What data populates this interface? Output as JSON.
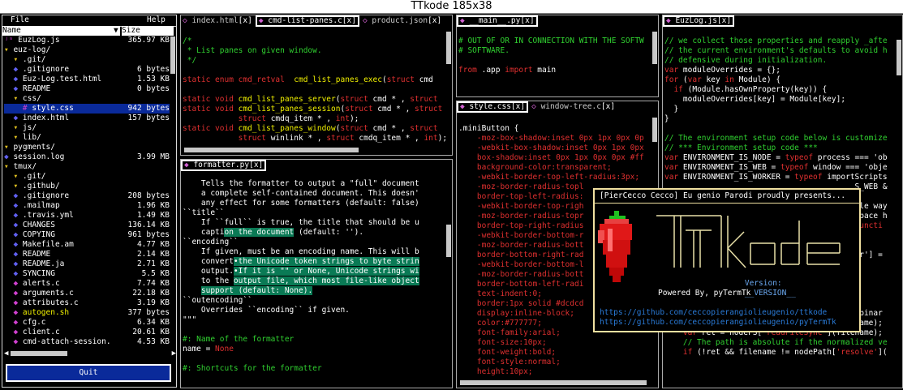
{
  "window": {
    "title": "TTkode 185x38"
  },
  "menu": {
    "file": "File",
    "help": "Help"
  },
  "file_tree": {
    "col_name": "Name",
    "col_size": "Size",
    "sort_indicator": "▼",
    "items": [
      {
        "icon": "js",
        "name": "EuzLog.js",
        "size": "365.97 KB",
        "indent": 0
      },
      {
        "icon": "folder",
        "name": "euz-log/",
        "size": "",
        "indent": 0
      },
      {
        "icon": "folder",
        "name": ".git/",
        "size": "",
        "indent": 1
      },
      {
        "icon": "file",
        "name": ".gitignore",
        "size": "6 bytes",
        "indent": 1
      },
      {
        "icon": "file",
        "name": "Euz-Log.test.html",
        "size": "1.53 KB",
        "indent": 1
      },
      {
        "icon": "file",
        "name": "README",
        "size": "0 bytes",
        "indent": 1
      },
      {
        "icon": "folder",
        "name": "css/",
        "size": "",
        "indent": 1
      },
      {
        "icon": "css",
        "name": "style.css",
        "size": "942 bytes",
        "indent": 2
      },
      {
        "icon": "file",
        "name": "index.html",
        "size": "157 bytes",
        "indent": 1
      },
      {
        "icon": "folder",
        "name": "js/",
        "size": "",
        "indent": 1
      },
      {
        "icon": "folder",
        "name": "lib/",
        "size": "",
        "indent": 1
      },
      {
        "icon": "folder",
        "name": "pygments/",
        "size": "",
        "indent": 0
      },
      {
        "icon": "file",
        "name": "session.log",
        "size": "3.99 MB",
        "indent": 0
      },
      {
        "icon": "folder",
        "name": "tmux/",
        "size": "",
        "indent": 0
      },
      {
        "icon": "folder",
        "name": ".git/",
        "size": "",
        "indent": 1
      },
      {
        "icon": "folder",
        "name": ".github/",
        "size": "",
        "indent": 1
      },
      {
        "icon": "file",
        "name": ".gitignore",
        "size": "208 bytes",
        "indent": 1
      },
      {
        "icon": "file",
        "name": ".mailmap",
        "size": "1.96 KB",
        "indent": 1
      },
      {
        "icon": "file",
        "name": ".travis.yml",
        "size": "1.49 KB",
        "indent": 1
      },
      {
        "icon": "file",
        "name": "CHANGES",
        "size": "136.14 KB",
        "indent": 1
      },
      {
        "icon": "file",
        "name": "COPYING",
        "size": "961 bytes",
        "indent": 1
      },
      {
        "icon": "file",
        "name": "Makefile.am",
        "size": "4.77 KB",
        "indent": 1
      },
      {
        "icon": "file",
        "name": "README",
        "size": "2.14 KB",
        "indent": 1
      },
      {
        "icon": "file",
        "name": "README.ja",
        "size": "2.71 KB",
        "indent": 1
      },
      {
        "icon": "file",
        "name": "SYNCING",
        "size": "5.5 KB",
        "indent": 1
      },
      {
        "icon": "c",
        "name": "alerts.c",
        "size": "7.74 KB",
        "indent": 1
      },
      {
        "icon": "c",
        "name": "arguments.c",
        "size": "22.18 KB",
        "indent": 1
      },
      {
        "icon": "c",
        "name": "attributes.c",
        "size": "3.19 KB",
        "indent": 1
      },
      {
        "icon": "sh",
        "name": "autogen.sh",
        "size": "377 bytes",
        "indent": 1
      },
      {
        "icon": "c",
        "name": "cfg.c",
        "size": "6.34 KB",
        "indent": 1
      },
      {
        "icon": "c",
        "name": "client.c",
        "size": "20.61 KB",
        "indent": 1
      },
      {
        "icon": "c",
        "name": "cmd-attach-session.",
        "size": "4.53 KB",
        "indent": 1
      }
    ],
    "selected_index": 7,
    "quit_label": "Quit"
  },
  "pane1": {
    "tabs": [
      {
        "label": "index.html",
        "active": false
      },
      {
        "label": "cmd-list-panes.c",
        "active": true
      },
      {
        "label": "product.json",
        "active": false
      }
    ],
    "lines": [
      [
        {
          "t": "/*",
          "c": "cm"
        }
      ],
      [
        {
          "t": " * List panes on given window.",
          "c": "cm"
        }
      ],
      [
        {
          "t": " */",
          "c": "cm"
        }
      ],
      [
        {
          "t": "",
          "c": ""
        }
      ],
      [
        {
          "t": "static enum ",
          "c": "kw"
        },
        {
          "t": "cmd_retval  ",
          "c": "ty"
        },
        {
          "t": "cmd_list_panes_exec",
          "c": "fn"
        },
        {
          "t": "(",
          "c": ""
        },
        {
          "t": "struct ",
          "c": "kw"
        },
        {
          "t": "cmd",
          "c": ""
        }
      ],
      [
        {
          "t": "",
          "c": ""
        }
      ],
      [
        {
          "t": "static void ",
          "c": "kw"
        },
        {
          "t": "cmd_list_panes_server",
          "c": "fn"
        },
        {
          "t": "(",
          "c": ""
        },
        {
          "t": "struct ",
          "c": "kw"
        },
        {
          "t": "cmd * , ",
          "c": ""
        },
        {
          "t": "struct",
          "c": "kw"
        }
      ],
      [
        {
          "t": "static void ",
          "c": "kw"
        },
        {
          "t": "cmd_list_panes_session",
          "c": "fn"
        },
        {
          "t": "(",
          "c": ""
        },
        {
          "t": "struct ",
          "c": "kw"
        },
        {
          "t": "cmd * , ",
          "c": ""
        },
        {
          "t": "struct",
          "c": "kw"
        }
      ],
      [
        {
          "t": "            ",
          "c": ""
        },
        {
          "t": "struct ",
          "c": "kw"
        },
        {
          "t": "cmdq_item * , ",
          "c": ""
        },
        {
          "t": "int",
          "c": "kw"
        },
        {
          "t": ");",
          "c": ""
        }
      ],
      [
        {
          "t": "static void ",
          "c": "kw"
        },
        {
          "t": "cmd_list_panes_window",
          "c": "fn"
        },
        {
          "t": "(",
          "c": ""
        },
        {
          "t": "struct ",
          "c": "kw"
        },
        {
          "t": "cmd * , ",
          "c": ""
        },
        {
          "t": "struct",
          "c": "kw"
        }
      ],
      [
        {
          "t": "            ",
          "c": ""
        },
        {
          "t": "struct ",
          "c": "kw"
        },
        {
          "t": "winlink * , ",
          "c": ""
        },
        {
          "t": "struct ",
          "c": "kw"
        },
        {
          "t": "cmdq_item * , ",
          "c": ""
        },
        {
          "t": "int",
          "c": "kw"
        },
        {
          "t": ");v",
          "c": ""
        }
      ]
    ]
  },
  "pane2": {
    "tabs": [
      {
        "label": "formatter.py",
        "active": true
      }
    ],
    "lines": [
      [
        {
          "t": "    Tells the formatter to output a \"full\" document",
          "c": ""
        }
      ],
      [
        {
          "t": "    a complete self-contained document. This doesn'",
          "c": ""
        }
      ],
      [
        {
          "t": "    any effect for some formatters (default: false)",
          "c": ""
        }
      ],
      [
        {
          "t": "``title``",
          "c": ""
        }
      ],
      [
        {
          "t": "    If ``full`` is true, the title that should be u",
          "c": ""
        }
      ],
      [
        {
          "t": "    capti",
          "c": ""
        },
        {
          "t": "on the document",
          "c": "sel"
        },
        {
          "t": " (default: '').",
          "c": ""
        }
      ],
      [
        {
          "t": "``encoding``",
          "c": ""
        }
      ],
      [
        {
          "t": "    If given, must be an encoding name. This will b",
          "c": ""
        }
      ],
      [
        {
          "t": "    convert",
          "c": ""
        },
        {
          "t": "•the Unicode token strings to byte strin",
          "c": "sel"
        }
      ],
      [
        {
          "t": "    output.",
          "c": ""
        },
        {
          "t": "•If it is \"\" or None, Unicode strings wi",
          "c": "sel"
        }
      ],
      [
        {
          "t": "    to the ",
          "c": ""
        },
        {
          "t": "output file, which most file-like object",
          "c": "sel"
        }
      ],
      [
        {
          "t": "    ",
          "c": ""
        },
        {
          "t": "support (default: None).",
          "c": "sel"
        }
      ],
      [
        {
          "t": "``outencoding``",
          "c": ""
        }
      ],
      [
        {
          "t": "    Overrides ``encoding`` if given.",
          "c": ""
        }
      ],
      [
        {
          "t": "\"\"\"",
          "c": ""
        }
      ],
      [
        {
          "t": "",
          "c": ""
        }
      ],
      [
        {
          "t": "#: Name of the formatter",
          "c": "cm"
        }
      ],
      [
        {
          "t": "name = ",
          "c": ""
        },
        {
          "t": "None",
          "c": "kw"
        }
      ],
      [
        {
          "t": "",
          "c": ""
        }
      ],
      [
        {
          "t": "#: Shortcuts for the formatter",
          "c": "cm"
        }
      ]
    ]
  },
  "pane3": {
    "tabs": [
      {
        "label": "__main__.py",
        "active": true
      }
    ],
    "lines": [
      [
        {
          "t": "# OUT OF OR IN CONNECTION WITH THE SOFTW",
          "c": "cm"
        }
      ],
      [
        {
          "t": "# SOFTWARE.",
          "c": "cm"
        }
      ],
      [
        {
          "t": "",
          "c": ""
        }
      ],
      [
        {
          "t": "from ",
          "c": "kw"
        },
        {
          "t": ".app ",
          "c": ""
        },
        {
          "t": "import ",
          "c": "kw"
        },
        {
          "t": "main",
          "c": ""
        }
      ]
    ]
  },
  "pane4": {
    "tabs": [
      {
        "label": "style.css",
        "active": true
      },
      {
        "label": "window-tree.c",
        "active": false
      }
    ],
    "lines": [
      [
        {
          "t": ".miniButton {",
          "c": ""
        }
      ],
      [
        {
          "t": "    -moz-box-shadow:inset 0px 1px 0px 0p",
          "c": "kw"
        }
      ],
      [
        {
          "t": "    -webkit-box-shadow:inset 0px 1px 0px",
          "c": "kw"
        }
      ],
      [
        {
          "t": "    box-shadow:inset 0px 1px 0px 0px #ff",
          "c": "kw"
        }
      ],
      [
        {
          "t": "    background-color:transparent;",
          "c": "kw"
        }
      ],
      [
        {
          "t": "    -webkit-border-top-left-radius:3px;",
          "c": "kw"
        }
      ],
      [
        {
          "t": "    -moz-border-radius-topl",
          "c": "kw"
        }
      ],
      [
        {
          "t": "    border-top-left-radius:",
          "c": "kw"
        }
      ],
      [
        {
          "t": "    -webkit-border-top-righ",
          "c": "kw"
        }
      ],
      [
        {
          "t": "    -moz-border-radius-topr",
          "c": "kw"
        }
      ],
      [
        {
          "t": "    border-top-right-radius",
          "c": "kw"
        }
      ],
      [
        {
          "t": "    -webkit-border-bottom-r",
          "c": "kw"
        }
      ],
      [
        {
          "t": "    -moz-border-radius-bott",
          "c": "kw"
        }
      ],
      [
        {
          "t": "    border-bottom-right-rad",
          "c": "kw"
        }
      ],
      [
        {
          "t": "    -webkit-border-bottom-l",
          "c": "kw"
        }
      ],
      [
        {
          "t": "    -moz-border-radius-bott",
          "c": "kw"
        }
      ],
      [
        {
          "t": "    border-bottom-left-radi",
          "c": "kw"
        }
      ],
      [
        {
          "t": "    text-indent:0;",
          "c": "kw"
        }
      ],
      [
        {
          "t": "    border:1px solid #dcdcd",
          "c": "kw"
        }
      ],
      [
        {
          "t": "    display:inline-block;",
          "c": "kw"
        }
      ],
      [
        {
          "t": "    color:#777777;",
          "c": "kw"
        }
      ],
      [
        {
          "t": "    font-family:arial;",
          "c": "kw"
        }
      ],
      [
        {
          "t": "    font-size:10px;",
          "c": "kw"
        }
      ],
      [
        {
          "t": "    font-weight:bold;",
          "c": "kw"
        }
      ],
      [
        {
          "t": "    font-style:normal;",
          "c": "kw"
        }
      ],
      [
        {
          "t": "    height:10px;",
          "c": "kw"
        }
      ]
    ]
  },
  "pane5": {
    "tabs": [
      {
        "label": "EuzLog.js",
        "active": true
      }
    ],
    "lines": [
      [
        {
          "t": "// we collect those properties and reapply _afte",
          "c": "cm"
        }
      ],
      [
        {
          "t": "// the current environment's defaults to avoid h",
          "c": "cm"
        }
      ],
      [
        {
          "t": "// defensive during initialization.",
          "c": "cm"
        }
      ],
      [
        {
          "t": "var ",
          "c": "kw"
        },
        {
          "t": "moduleOverrides = {};",
          "c": ""
        }
      ],
      [
        {
          "t": "for ",
          "c": "kw"
        },
        {
          "t": "(",
          "c": ""
        },
        {
          "t": "var ",
          "c": "kw"
        },
        {
          "t": "key ",
          "c": ""
        },
        {
          "t": "in ",
          "c": "kw"
        },
        {
          "t": "Module) {",
          "c": ""
        }
      ],
      [
        {
          "t": "  ",
          "c": ""
        },
        {
          "t": "if ",
          "c": "kw"
        },
        {
          "t": "(Module.hasOwnProperty(key)) {",
          "c": ""
        }
      ],
      [
        {
          "t": "    moduleOverrides[key] = Module[key];",
          "c": ""
        }
      ],
      [
        {
          "t": "  }",
          "c": ""
        }
      ],
      [
        {
          "t": "}",
          "c": ""
        }
      ],
      [
        {
          "t": "",
          "c": ""
        }
      ],
      [
        {
          "t": "// The environment setup code below is customize",
          "c": "cm"
        }
      ],
      [
        {
          "t": "// *** Environment setup code",
          "c": "cm"
        },
        {
          "t": " ***",
          "c": "cm"
        }
      ],
      [
        {
          "t": "var ",
          "c": "kw"
        },
        {
          "t": "ENVIRONMENT_IS_NODE = ",
          "c": ""
        },
        {
          "t": "typeof ",
          "c": "kw"
        },
        {
          "t": "process === 'ob",
          "c": ""
        }
      ],
      [
        {
          "t": "var ",
          "c": "kw"
        },
        {
          "t": "ENVIRONMENT_IS_WEB = ",
          "c": ""
        },
        {
          "t": "typeof ",
          "c": "kw"
        },
        {
          "t": "window === 'obje",
          "c": ""
        }
      ],
      [
        {
          "t": "var ",
          "c": "kw"
        },
        {
          "t": "ENVIRONMENT_IS_WORKER = ",
          "c": ""
        },
        {
          "t": "typeof ",
          "c": "kw"
        },
        {
          "t": "importScripts",
          "c": ""
        }
      ],
      [
        {
          "t": "                                         S_WEB &",
          "c": ""
        }
      ],
      [
        {
          "t": "",
          "c": ""
        }
      ],
      [
        {
          "t": "                                         ple way",
          "c": ""
        }
      ],
      [
        {
          "t": "                                         space h",
          "c": ""
        }
      ],
      [
        {
          "t": "                                         functi",
          "c": "kw"
        }
      ],
      [
        {
          "t": "",
          "c": ""
        }
      ],
      [
        {
          "t": "",
          "c": ""
        }
      ],
      [
        {
          "t": "                                         rr'] =",
          "c": ""
        }
      ],
      [
        {
          "t": "",
          "c": ""
        }
      ],
      [
        {
          "t": "",
          "c": ""
        }
      ],
      [
        {
          "t": "",
          "c": ""
        }
      ],
      [
        {
          "t": "",
          "c": ""
        }
      ],
      [
        {
          "t": "",
          "c": ""
        }
      ],
      [
        {
          "t": "                                        , binar",
          "c": ""
        }
      ],
      [
        {
          "t": "    filename = nodePath[",
          "c": ""
        },
        {
          "t": "'normalize'",
          "c": "str"
        },
        {
          "t": "](filename);",
          "c": ""
        }
      ],
      [
        {
          "t": "    ",
          "c": ""
        },
        {
          "t": "var ",
          "c": "kw"
        },
        {
          "t": "ret = nodeFS[",
          "c": ""
        },
        {
          "t": "'readFileSync'",
          "c": "str"
        },
        {
          "t": "](filename);",
          "c": ""
        }
      ],
      [
        {
          "t": "    // The path is absolute if the normalized ve",
          "c": "cm"
        }
      ],
      [
        {
          "t": "    ",
          "c": ""
        },
        {
          "t": "if ",
          "c": "kw"
        },
        {
          "t": "(!ret && filename != nodePath[",
          "c": ""
        },
        {
          "t": "'resolve'",
          "c": "str"
        },
        {
          "t": "](",
          "c": ""
        }
      ]
    ]
  },
  "splash": {
    "title": "[PierCecco Cecco] Eu genio Parodi proudly presents...",
    "powered_by": "Powered By, pyTermTk",
    "version_label": "Version:",
    "version_value": "__VERSION__",
    "links": [
      "https://github.com/ceccopierangiolieugenio/ttkode",
      "https://github.com/ceccopierangiolieugenio/pyTermTk"
    ],
    "logo_text": "ttkode",
    "colors": {
      "border": "#f0e0a0",
      "pepper": "#e01818",
      "stem": "#20c020",
      "logo": "#e8e0a8",
      "link": "#2a7bd8"
    }
  },
  "colors": {
    "background": "#000000",
    "keyword": "#e03030",
    "function": "#f0f000",
    "comment": "#30d030",
    "selection": "#0a7a55",
    "file_selected": "#0a2a9a",
    "quit_button": "#0a2a9a"
  }
}
